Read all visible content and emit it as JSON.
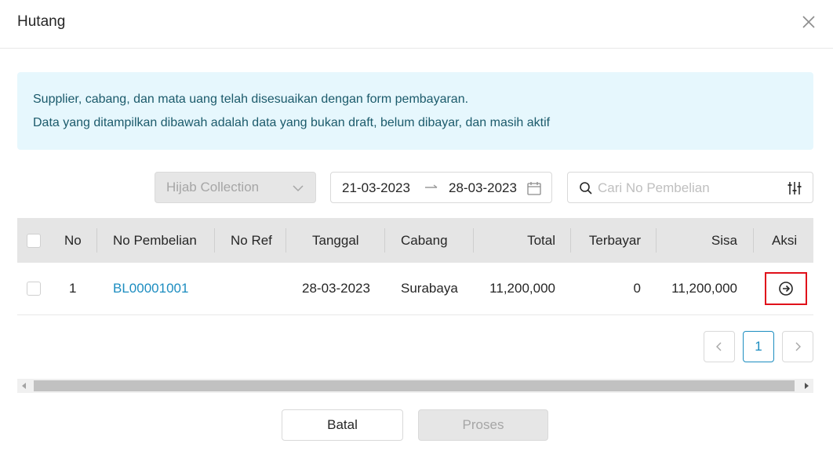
{
  "modal": {
    "title": "Hutang"
  },
  "info": {
    "line1": "Supplier, cabang, dan mata uang telah disesuaikan dengan form pembayaran.",
    "line2": "Data yang ditampilkan dibawah adalah data yang bukan draft, belum dibayar, dan masih aktif"
  },
  "filters": {
    "branch": "Hijab Collection",
    "date_from": "21-03-2023",
    "date_to": "28-03-2023",
    "search_placeholder": "Cari No Pembelian"
  },
  "table": {
    "headers": {
      "no": "No",
      "no_pembelian": "No Pembelian",
      "no_ref": "No Ref",
      "tanggal": "Tanggal",
      "cabang": "Cabang",
      "total": "Total",
      "terbayar": "Terbayar",
      "sisa": "Sisa",
      "aksi": "Aksi"
    },
    "rows": [
      {
        "no": "1",
        "no_pembelian": "BL00001001",
        "no_ref": "",
        "tanggal": "28-03-2023",
        "cabang": "Surabaya",
        "total": "11,200,000",
        "terbayar": "0",
        "sisa": "11,200,000"
      }
    ]
  },
  "pagination": {
    "current_page": "1"
  },
  "buttons": {
    "cancel": "Batal",
    "process": "Proses"
  },
  "icons": {
    "close": "close-icon",
    "dropdown": "chevron-down-icon",
    "date_arrow": "arrow-right-icon",
    "calendar": "calendar-icon",
    "search": "search-icon",
    "filter": "filter-sliders-icon",
    "row_action": "arrow-right-circle-icon"
  },
  "colors": {
    "link": "#1c8dc0",
    "info_background": "#e6f7fd",
    "info_text": "#1b5a6b",
    "highlight": "#e0101a"
  }
}
